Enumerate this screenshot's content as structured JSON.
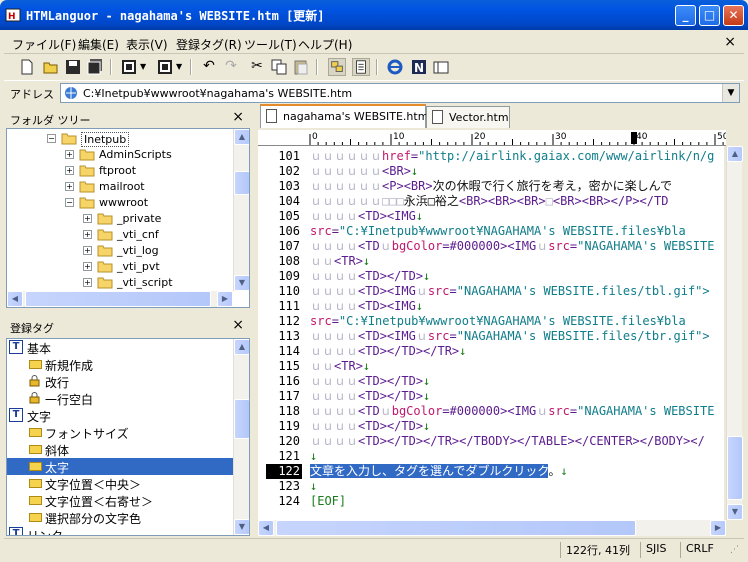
{
  "window": {
    "title": "HTMLanguor - nagahama's WEBSITE.htm [更新]",
    "min_icon": "minimize-icon",
    "max_icon": "maximize-icon",
    "close_icon": "close-icon"
  },
  "menu": {
    "items": [
      "ファイル(F)",
      "編集(E)",
      "表示(V)",
      "登録タグ(R)",
      "ツール(T)",
      "ヘルプ(H)"
    ],
    "close": "×"
  },
  "address": {
    "label": "アドレス",
    "value": "C:¥Inetpub¥wwwroot¥nagahama's WEBSITE.htm"
  },
  "folder_tree": {
    "title": "フォルダ ツリー",
    "close": "×",
    "items": [
      {
        "label": "Inetpub",
        "level": 0,
        "expander": "−"
      },
      {
        "label": "AdminScripts",
        "level": 1,
        "expander": "+"
      },
      {
        "label": "ftproot",
        "level": 1,
        "expander": "+"
      },
      {
        "label": "mailroot",
        "level": 1,
        "expander": "+"
      },
      {
        "label": "wwwroot",
        "level": 1,
        "expander": "−"
      },
      {
        "label": "_private",
        "level": 2,
        "expander": "+"
      },
      {
        "label": "_vti_cnf",
        "level": 2,
        "expander": "+"
      },
      {
        "label": "_vti_log",
        "level": 2,
        "expander": "+"
      },
      {
        "label": "_vti_pvt",
        "level": 2,
        "expander": "+"
      },
      {
        "label": "_vti_script",
        "level": 2,
        "expander": "+"
      }
    ]
  },
  "tag_panel": {
    "title": "登録タグ",
    "close": "×",
    "items": [
      {
        "label": "基本",
        "kind": "category",
        "icon": "T"
      },
      {
        "label": "新規作成",
        "kind": "tag"
      },
      {
        "label": "改行",
        "kind": "lock"
      },
      {
        "label": "一行空白",
        "kind": "lock"
      },
      {
        "label": "文字",
        "kind": "category",
        "icon": "T"
      },
      {
        "label": "フォントサイズ",
        "kind": "tag"
      },
      {
        "label": "斜体",
        "kind": "tag"
      },
      {
        "label": "太字",
        "kind": "tag",
        "selected": true
      },
      {
        "label": "文字位置＜中央＞",
        "kind": "tag"
      },
      {
        "label": "文字位置＜右寄せ＞",
        "kind": "tag"
      },
      {
        "label": "選択部分の文字色",
        "kind": "tag"
      },
      {
        "label": "リンク",
        "kind": "category",
        "icon": "T"
      }
    ]
  },
  "tabs": [
    {
      "label": "nagahama's WEBSITE.htm",
      "active": true
    },
    {
      "label": "Vector.htm",
      "active": false
    }
  ],
  "ruler": {
    "marks": [
      "0",
      "10",
      "20",
      "30",
      "40",
      "50"
    ]
  },
  "editor": {
    "current_line": 122,
    "lines": [
      {
        "n": "101",
        "segs": [
          [
            "sp",
            "ｕｕｕｕｕｕ"
          ],
          [
            "at",
            "href"
          ],
          [
            "tg",
            "="
          ],
          [
            "st",
            "\"http://airlink.gaiax.com/www/airlink/n/g"
          ]
        ]
      },
      {
        "n": "102",
        "segs": [
          [
            "sp",
            "ｕｕｕｕｕｕ"
          ],
          [
            "tg",
            "<BR>"
          ],
          [
            "nl",
            "↓"
          ]
        ]
      },
      {
        "n": "103",
        "segs": [
          [
            "sp",
            "ｕｕｕｕｕｕ"
          ],
          [
            "tg",
            "<P><BR>"
          ],
          [
            "tx",
            "次の休暇で行く旅行を考え，密かに楽しんで"
          ]
        ]
      },
      {
        "n": "104",
        "segs": [
          [
            "sp",
            "ｕｕｕｕｕｕ□□□"
          ],
          [
            "tx",
            "永浜□裕之"
          ],
          [
            "tg",
            "<BR><BR><BR>"
          ],
          [
            "sp",
            "□"
          ],
          [
            "tg",
            "<BR><BR></P></TD"
          ]
        ]
      },
      {
        "n": "105",
        "segs": [
          [
            "sp",
            "ｕｕｕｕ"
          ],
          [
            "tg",
            "<TD><IMG"
          ],
          [
            "nl",
            "↓"
          ]
        ]
      },
      {
        "n": "106",
        "segs": [
          [
            "at",
            "src"
          ],
          [
            "tg",
            "="
          ],
          [
            "st",
            "\"C:¥Inetpub¥wwwroot¥NAGAHAMA's WEBSITE.files¥bla"
          ]
        ]
      },
      {
        "n": "107",
        "segs": [
          [
            "sp",
            "ｕｕｕｕ"
          ],
          [
            "tg",
            "<TD"
          ],
          [
            "sp",
            "ｕ"
          ],
          [
            "at",
            "bgColor"
          ],
          [
            "tg",
            "=#000000><IMG"
          ],
          [
            "sp",
            "ｕ"
          ],
          [
            "at",
            "src"
          ],
          [
            "tg",
            "="
          ],
          [
            "st",
            "\"NAGAHAMA's WEBSITE"
          ]
        ]
      },
      {
        "n": "108",
        "segs": [
          [
            "sp",
            "ｕｕ"
          ],
          [
            "tg",
            "<TR>"
          ],
          [
            "nl",
            "↓"
          ]
        ]
      },
      {
        "n": "109",
        "segs": [
          [
            "sp",
            "ｕｕｕｕ"
          ],
          [
            "tg",
            "<TD></TD>"
          ],
          [
            "nl",
            "↓"
          ]
        ]
      },
      {
        "n": "110",
        "segs": [
          [
            "sp",
            "ｕｕｕｕ"
          ],
          [
            "tg",
            "<TD><IMG"
          ],
          [
            "sp",
            "ｕ"
          ],
          [
            "at",
            "src"
          ],
          [
            "tg",
            "="
          ],
          [
            "st",
            "\"NAGAHAMA's WEBSITE.files/tbl.gif\">"
          ]
        ]
      },
      {
        "n": "111",
        "segs": [
          [
            "sp",
            "ｕｕｕｕ"
          ],
          [
            "tg",
            "<TD><IMG"
          ],
          [
            "nl",
            "↓"
          ]
        ]
      },
      {
        "n": "112",
        "segs": [
          [
            "at",
            "src"
          ],
          [
            "tg",
            "="
          ],
          [
            "st",
            "\"C:¥Inetpub¥wwwroot¥NAGAHAMA's WEBSITE.files¥bla"
          ]
        ]
      },
      {
        "n": "113",
        "segs": [
          [
            "sp",
            "ｕｕｕｕ"
          ],
          [
            "tg",
            "<TD><IMG"
          ],
          [
            "sp",
            "ｕ"
          ],
          [
            "at",
            "src"
          ],
          [
            "tg",
            "="
          ],
          [
            "st",
            "\"NAGAHAMA's WEBSITE.files/tbr.gif\">"
          ]
        ]
      },
      {
        "n": "114",
        "segs": [
          [
            "sp",
            "ｕｕｕｕ"
          ],
          [
            "tg",
            "<TD></TD></TR>"
          ],
          [
            "nl",
            "↓"
          ]
        ]
      },
      {
        "n": "115",
        "segs": [
          [
            "sp",
            "ｕｕ"
          ],
          [
            "tg",
            "<TR>"
          ],
          [
            "nl",
            "↓"
          ]
        ]
      },
      {
        "n": "116",
        "segs": [
          [
            "sp",
            "ｕｕｕｕ"
          ],
          [
            "tg",
            "<TD></TD>"
          ],
          [
            "nl",
            "↓"
          ]
        ]
      },
      {
        "n": "117",
        "segs": [
          [
            "sp",
            "ｕｕｕｕ"
          ],
          [
            "tg",
            "<TD></TD>"
          ],
          [
            "nl",
            "↓"
          ]
        ]
      },
      {
        "n": "118",
        "segs": [
          [
            "sp",
            "ｕｕｕｕ"
          ],
          [
            "tg",
            "<TD"
          ],
          [
            "sp",
            "ｕ"
          ],
          [
            "at",
            "bgColor"
          ],
          [
            "tg",
            "=#000000><IMG"
          ],
          [
            "sp",
            "ｕ"
          ],
          [
            "at",
            "src"
          ],
          [
            "tg",
            "="
          ],
          [
            "st",
            "\"NAGAHAMA's WEBSITE"
          ]
        ]
      },
      {
        "n": "119",
        "segs": [
          [
            "sp",
            "ｕｕｕｕ"
          ],
          [
            "tg",
            "<TD></TD>"
          ],
          [
            "nl",
            "↓"
          ]
        ]
      },
      {
        "n": "120",
        "segs": [
          [
            "sp",
            "ｕｕｕｕ"
          ],
          [
            "tg",
            "<TD></TD></TR></TBODY></TABLE></CENTER></BODY></"
          ]
        ]
      },
      {
        "n": "121",
        "segs": [
          [
            "nl",
            "↓"
          ]
        ]
      },
      {
        "n": "122",
        "segs": [
          [
            "selt",
            "文章を入力し、タグを選んでダブルクリック"
          ],
          [
            "tx",
            "。"
          ],
          [
            "nl",
            "↓"
          ]
        ]
      },
      {
        "n": "123",
        "segs": [
          [
            "nl",
            "↓"
          ]
        ]
      },
      {
        "n": "124",
        "segs": [
          [
            "nl",
            "[EOF]"
          ]
        ]
      }
    ]
  },
  "status": {
    "position": "122行, 41列",
    "encoding": "SJIS",
    "newline": "CRLF"
  },
  "colors": {
    "tag": "#5b1c8e",
    "attribute": "#c0186d",
    "string": "#0f7d8a",
    "newline_mark": "#1a7b1a",
    "selection": "#316ac5"
  }
}
